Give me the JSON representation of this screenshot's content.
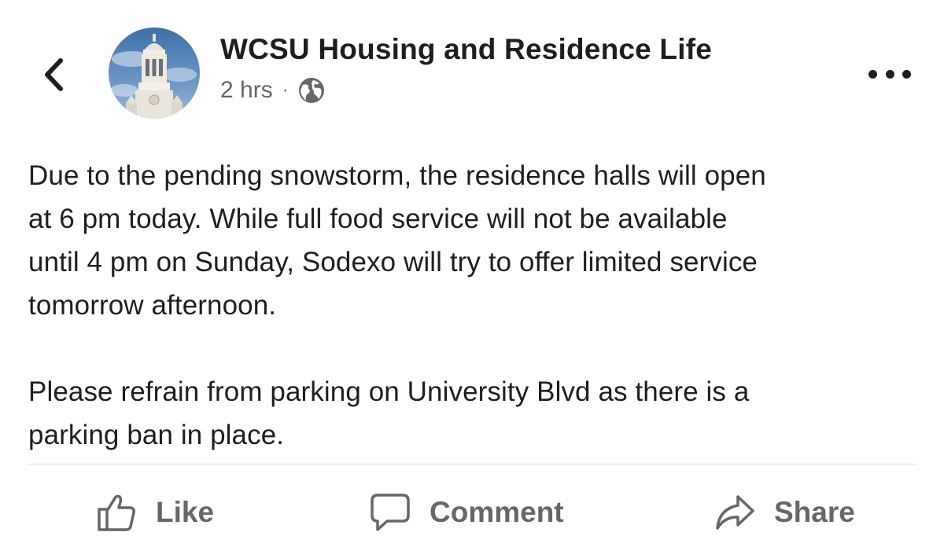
{
  "header": {
    "author": "WCSU Housing and Residence Life",
    "time": "2 hrs",
    "separator": "·",
    "icons": {
      "back": "chevron-left-icon",
      "privacy": "globe-icon",
      "more": "more-dots-icon"
    }
  },
  "post": {
    "paragraphs": [
      "Due to the pending snowstorm, the residence halls will open\nat 6 pm today.  While full food service will not be available\nuntil 4 pm on Sunday, Sodexo will try to offer limited service\ntomorrow afternoon.",
      "Please refrain from parking on University Blvd as there is a\nparking ban in place."
    ]
  },
  "actions": {
    "like": "Like",
    "comment": "Comment",
    "share": "Share"
  },
  "colors": {
    "text": "#1c1e21",
    "secondary": "#65676b",
    "divider": "#dadde1"
  }
}
